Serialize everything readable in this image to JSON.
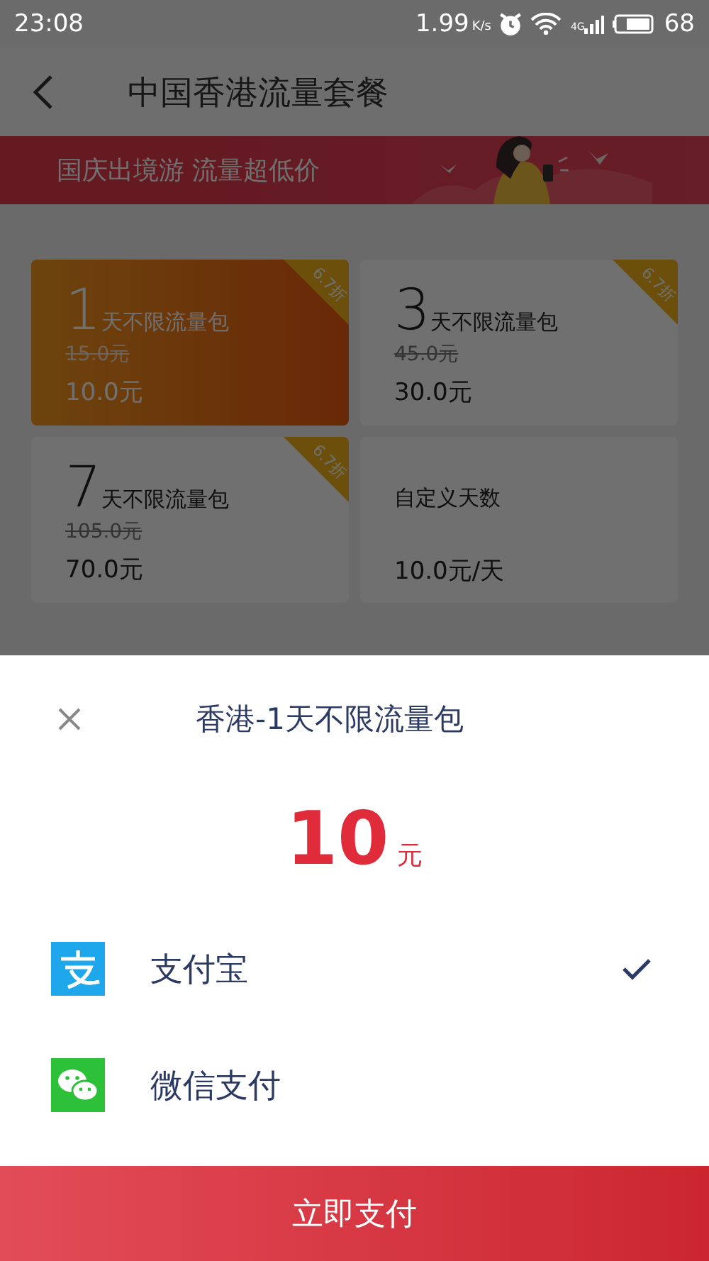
{
  "status_bar": {
    "time": "23:08",
    "speed": "1.99",
    "speed_unit": "K/s",
    "network": "4G",
    "battery": "68"
  },
  "header": {
    "title": "中国香港流量套餐"
  },
  "banner": {
    "text": "国庆出境游 流量超低价"
  },
  "packages": [
    {
      "kind": "bundle",
      "days": "1",
      "name": "天不限流量包",
      "original_price": "15.0元",
      "price": "10.0元",
      "discount": "6.7折",
      "selected": true
    },
    {
      "kind": "bundle",
      "days": "3",
      "name": "天不限流量包",
      "original_price": "45.0元",
      "price": "30.0元",
      "discount": "6.7折",
      "selected": false
    },
    {
      "kind": "bundle",
      "days": "7",
      "name": "天不限流量包",
      "original_price": "105.0元",
      "price": "70.0元",
      "discount": "6.7折",
      "selected": false
    },
    {
      "kind": "custom",
      "name": "自定义天数",
      "price": "10.0元/天",
      "selected": false
    }
  ],
  "payment_sheet": {
    "title": "香港-1天不限流量包",
    "amount": "10",
    "currency": "元",
    "methods": [
      {
        "kind": "alipay",
        "name": "支付宝",
        "selected": true
      },
      {
        "kind": "wechat",
        "name": "微信支付",
        "selected": false
      }
    ],
    "pay_button": "立即支付"
  }
}
